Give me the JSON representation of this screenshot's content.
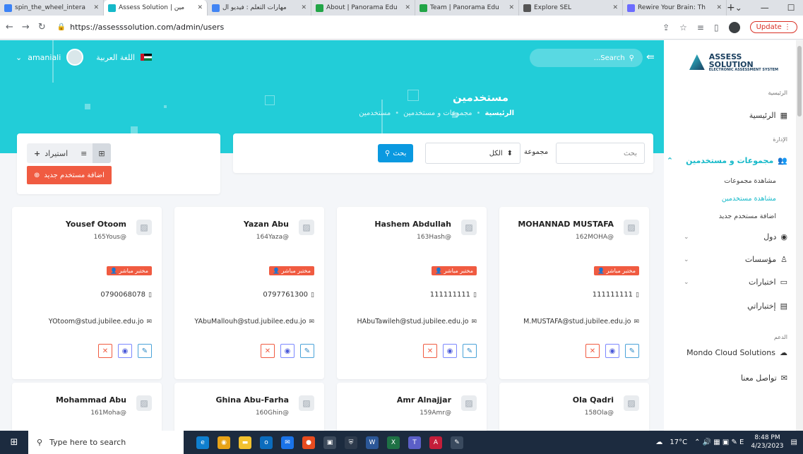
{
  "browser": {
    "tabs": [
      {
        "title": "spin_the_wheel_intera",
        "active": false,
        "fav": "#3b82f6"
      },
      {
        "title": "Assess Solution | مين",
        "active": true,
        "fav": "#16b9c9"
      },
      {
        "title": "مهارات التعلم : فيديو ال",
        "active": false,
        "fav": "#4285f4"
      },
      {
        "title": "About | Panorama Edu",
        "active": false,
        "fav": "#22a547"
      },
      {
        "title": "Team | Panorama Edu",
        "active": false,
        "fav": "#22a547"
      },
      {
        "title": "Explore SEL",
        "active": false,
        "fav": "#555555"
      },
      {
        "title": "Rewire Your Brain: Th",
        "active": false,
        "fav": "#6c6cff"
      }
    ],
    "url": "https://assesssolution.com/admin/users",
    "update_label": "Update"
  },
  "topbar": {
    "username": "amaniali",
    "language": "اللغة العربية",
    "search_placeholder": "...Search"
  },
  "page": {
    "title": "مستخدمين",
    "breadcrumb": [
      "الرئيسية",
      "مجموعات و مستخدمين",
      "مستخدمين"
    ]
  },
  "filter": {
    "search_placeholder": "بحث",
    "group_label": "مجموعة",
    "group_selected": "الكل",
    "search_button": "بحث"
  },
  "actions": {
    "import_label": "استيراد",
    "add_user_label": "اضافة مستخدم جديد"
  },
  "users": [
    {
      "name": "MOHANNAD MUSTAFA",
      "handle": "162MOHA@",
      "role": "مختبر مباشر",
      "phone": "111111111",
      "email": "M.MUSTAFA@stud.jubilee.edu.jo"
    },
    {
      "name": "Hashem Abdullah",
      "handle": "163Hash@",
      "role": "مختبر مباشر",
      "phone": "111111111",
      "email": "HAbuTawileh@stud.jubilee.edu.jo"
    },
    {
      "name": "Yazan Abu",
      "handle": "164Yaza@",
      "role": "مختبر مباشر",
      "phone": "0797761300",
      "email": "YAbuMallouh@stud.jubilee.edu.jo"
    },
    {
      "name": "Yousef Otoom",
      "handle": "165Yous@",
      "role": "مختبر مباشر",
      "phone": "0790068078",
      "email": "YOtoom@stud.jubilee.edu.jo"
    },
    {
      "name": "Ola Qadri",
      "handle": "158Ola@"
    },
    {
      "name": "Amr Alnajjar",
      "handle": "159Amr@"
    },
    {
      "name": "Ghina Abu-Farha",
      "handle": "160Ghin@"
    },
    {
      "name": "Mohammad Abu",
      "handle": "161Moha@"
    }
  ],
  "sidebar": {
    "logo_title": "ASSESS SOLUTION",
    "logo_subtitle": "ELECTRONIC ASSESSMENT SYSTEM",
    "section_home": "الرئيسية",
    "item_home": "الرئيسية",
    "section_admin": "الإدارة",
    "item_groups": "مجموعات و مستخدمين",
    "sub_view_groups": "مشاهدة مجموعات",
    "sub_view_users": "مشاهدة مستخدمين",
    "sub_add_user": "اضافة مستخدم جديد",
    "item_countries": "دول",
    "item_institutions": "مؤسسات",
    "item_tests": "اختبارات",
    "item_my_tests": "إختباراتي",
    "section_support": "الدعم",
    "item_mondo": "Mondo Cloud Solutions",
    "item_contact": "تواصل معنا"
  },
  "taskbar": {
    "search_placeholder": "Type here to search",
    "temperature": "17°C",
    "time": "8:48 PM",
    "date": "4/23/2023"
  }
}
